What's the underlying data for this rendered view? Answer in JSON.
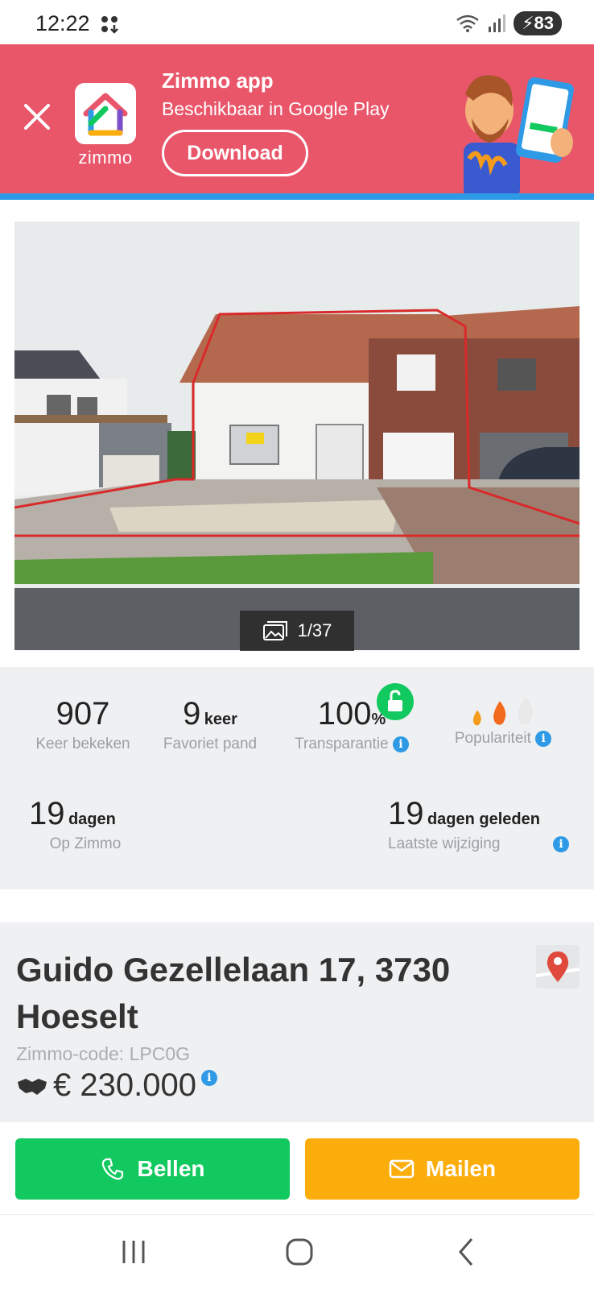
{
  "status_bar": {
    "time": "12:22",
    "battery": "83"
  },
  "banner": {
    "title": "Zimmo app",
    "subtitle": "Beschikbaar in Google Play",
    "app_label": "zimmo",
    "download_label": "Download",
    "background_color": "#e9566a",
    "accent_color": "#2e9ae6"
  },
  "photo": {
    "counter": "1/37"
  },
  "stats": {
    "views": {
      "value": "907",
      "label": "Keer bekeken"
    },
    "favorites": {
      "value": "9",
      "unit": "keer",
      "label": "Favoriet pand"
    },
    "transparency": {
      "value": "100",
      "unit": "%",
      "label": "Transparantie"
    },
    "popularity": {
      "label": "Populariteit",
      "level": 2,
      "max": 3
    },
    "on_zimmo": {
      "value": "19",
      "unit": "dagen",
      "label": "Op Zimmo"
    },
    "last_change": {
      "value": "19",
      "unit": "dagen geleden",
      "label": "Laatste wijziging"
    }
  },
  "listing": {
    "address": "Guido Gezellelaan 17, 3730 Hoeselt",
    "code": "Zimmo-code: LPC0G",
    "price": "€ 230.000"
  },
  "actions": {
    "call_label": "Bellen",
    "mail_label": "Mailen",
    "call_color": "#12c95f",
    "mail_color": "#fbad0c"
  }
}
